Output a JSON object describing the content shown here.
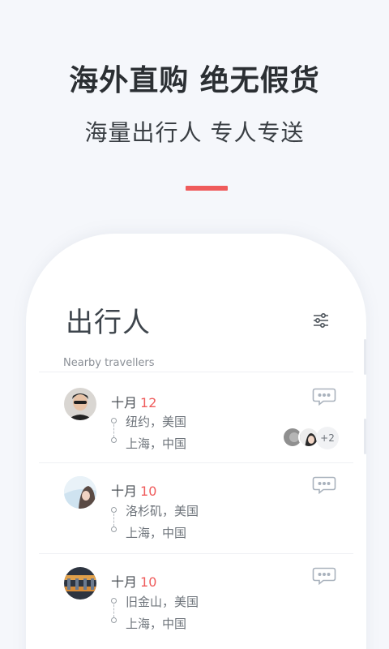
{
  "promo": {
    "headline": "海外直购 绝无假货",
    "subline": "海量出行人 专人专送"
  },
  "card": {
    "title": "出行人",
    "section_label": "Nearby travellers",
    "filter_icon": "sliders-icon"
  },
  "travellers": [
    {
      "month": "十月",
      "day": "12",
      "from": "纽约，美国",
      "to": "上海，中国",
      "companions_more": "+2"
    },
    {
      "month": "十月",
      "day": "10",
      "from": "洛杉矶，美国",
      "to": "上海，中国"
    },
    {
      "month": "十月",
      "day": "10",
      "from": "旧金山，美国",
      "to": "上海，中国"
    }
  ],
  "colors": {
    "accent": "#ef5b5b",
    "text_dark": "#2b2f33",
    "background": "#f5f7fb"
  }
}
